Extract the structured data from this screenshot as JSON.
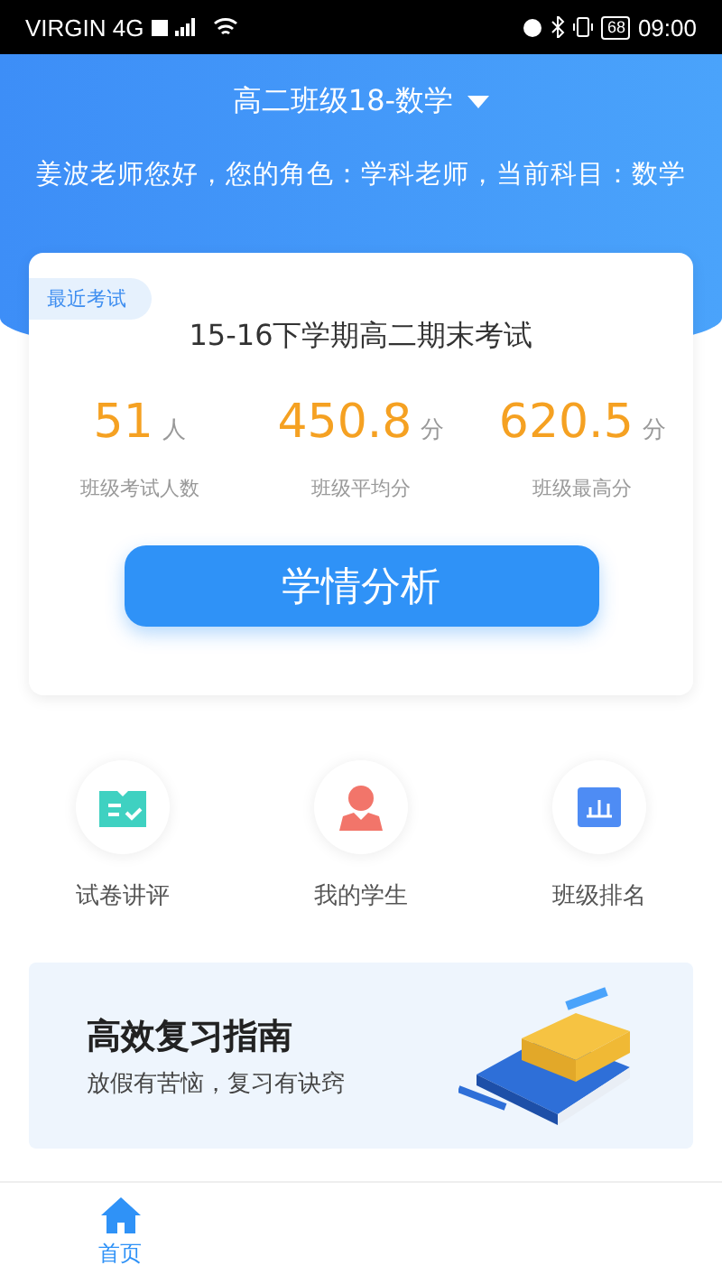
{
  "status_bar": {
    "carrier": "VIRGIN 4G",
    "battery": "68",
    "time": "09:00"
  },
  "header": {
    "class_selector": "高二班级18-数学",
    "greeting": "姜波老师您好，您的角色：学科老师，当前科目：数学"
  },
  "exam_card": {
    "tag": "最近考试",
    "title": "15-16下学期高二期末考试",
    "stats": [
      {
        "value": "51",
        "unit": "人",
        "label": "班级考试人数"
      },
      {
        "value": "450.8",
        "unit": "分",
        "label": "班级平均分"
      },
      {
        "value": "620.5",
        "unit": "分",
        "label": "班级最高分"
      }
    ],
    "button": "学情分析"
  },
  "shortcuts": [
    {
      "kind": "paper",
      "label": "试卷讲评"
    },
    {
      "kind": "student",
      "label": "我的学生"
    },
    {
      "kind": "ranking",
      "label": "班级排名"
    }
  ],
  "banner": {
    "title": "高效复习指南",
    "subtitle": "放假有苦恼，复习有诀窍"
  },
  "bottom_nav": [
    {
      "label": "首页",
      "selected": true
    }
  ]
}
